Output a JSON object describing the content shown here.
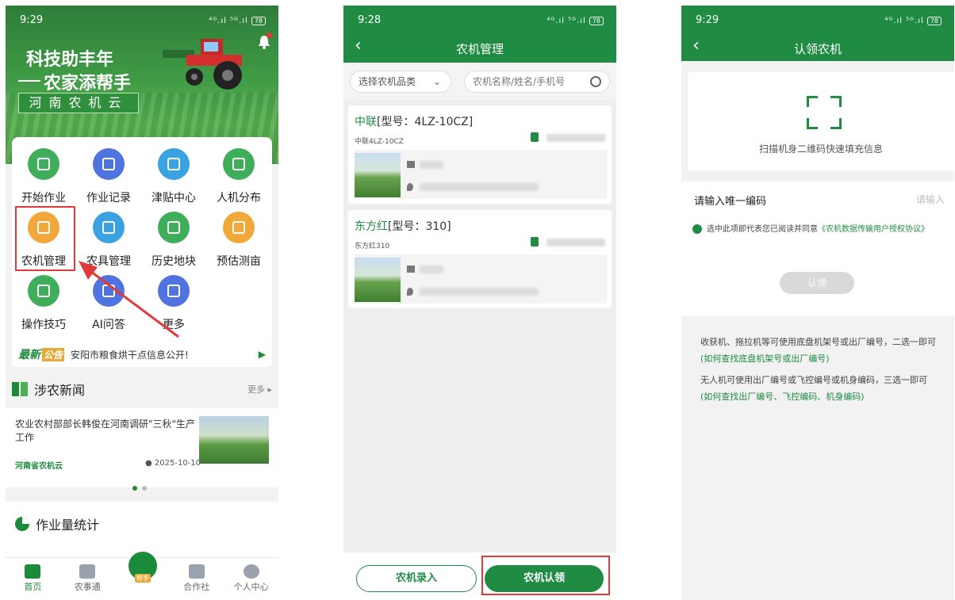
{
  "p1": {
    "time": "9:29",
    "signal": "⁴ᴳ.ıl ⁵ᴳ.ıl",
    "battery": "78",
    "slogan_line1": "科技助丰年",
    "slogan_line2": "农家添帮手",
    "brand": "河南农机云",
    "grid": [
      {
        "label": "开始作业",
        "color": "#3fae5a"
      },
      {
        "label": "作业记录",
        "color": "#4f73e0"
      },
      {
        "label": "津贴中心",
        "color": "#3aa2e0"
      },
      {
        "label": "人机分布",
        "color": "#3fae5a"
      },
      {
        "label": "农机管理",
        "color": "#f2a73b"
      },
      {
        "label": "农具管理",
        "color": "#3aa2e0"
      },
      {
        "label": "历史地块",
        "color": "#3fae5a"
      },
      {
        "label": "预估测亩",
        "color": "#f2a73b"
      },
      {
        "label": "操作技巧",
        "color": "#3fae5a"
      },
      {
        "label": "AI问答",
        "color": "#4f73e0"
      },
      {
        "label": "更多",
        "color": "#4f73e0"
      }
    ],
    "notice_tag": "最新",
    "notice_tag2": "公告",
    "notice_text": "安阳市粮食烘干点信息公开!",
    "news_title": "涉农新闻",
    "news_more": "更多 ▸",
    "news_item_title": "农业农村部部长韩俊在河南调研\"三秋\"生产工作",
    "news_item_source": "河南省农机云",
    "news_item_date": "2025-10-10",
    "stats_title": "作业量统计",
    "tabs": [
      "首页",
      "农事通",
      "合作社",
      "个人中心"
    ],
    "center_tab": "帮手"
  },
  "p2": {
    "time": "9:28",
    "title": "农机管理",
    "filter_select": "选择农机品类",
    "search_placeholder": "农机名称/姓名/手机号",
    "machines": [
      {
        "brand": "中联",
        "model": "[型号：4LZ-10CZ]",
        "sub": "中联4LZ-10CZ"
      },
      {
        "brand": "东方红",
        "model": "[型号：310]",
        "sub": "东方红310"
      }
    ],
    "btn_register": "农机录入",
    "btn_claim": "农机认领"
  },
  "p3": {
    "time": "9:29",
    "title": "认领农机",
    "scan_text": "扫描机身二维码快速填充信息",
    "input_label": "请输入唯一编码",
    "input_placeholder": "请输入",
    "agree_text": "选中此项即代表您已阅读并同意",
    "agree_link": "《农机数据传输用户授权协议》",
    "claim_button": "认领",
    "tip1": "收获机、拖拉机等可使用底盘机架号或出厂编号，二选一即可",
    "tip1_link": "(如何查找底盘机架号或出厂编号)",
    "tip2": "无人机可使用出厂编号或飞控编号或机身编码，三选一即可",
    "tip2_link": "(如何查找出厂编号、飞控编码、机身编码)"
  }
}
